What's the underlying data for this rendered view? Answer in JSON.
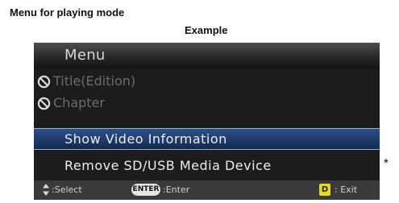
{
  "caption": {
    "title": "Menu for playing mode",
    "example": "Example"
  },
  "menu": {
    "title": "Menu",
    "items": [
      {
        "label": "Title(Edition)",
        "state": "disabled",
        "icon": "prohibited-icon"
      },
      {
        "label": "Chapter",
        "state": "disabled",
        "icon": "prohibited-icon"
      },
      {
        "label": "Show Video Information",
        "state": "selected"
      },
      {
        "label": "Remove SD/USB Media Device",
        "state": "enabled"
      }
    ]
  },
  "footer": {
    "select_icon": "up-down-arrows-icon",
    "select_label": ":Select",
    "enter_button": "ENTER",
    "enter_label": ":Enter",
    "exit_key": "D",
    "exit_label": ": Exit"
  },
  "note_marker": "*",
  "colors": {
    "selection": "#1f3b6c",
    "selection_border": "#8fb1e6",
    "exit_key": "#e6d830",
    "screen_background": "#000000"
  }
}
